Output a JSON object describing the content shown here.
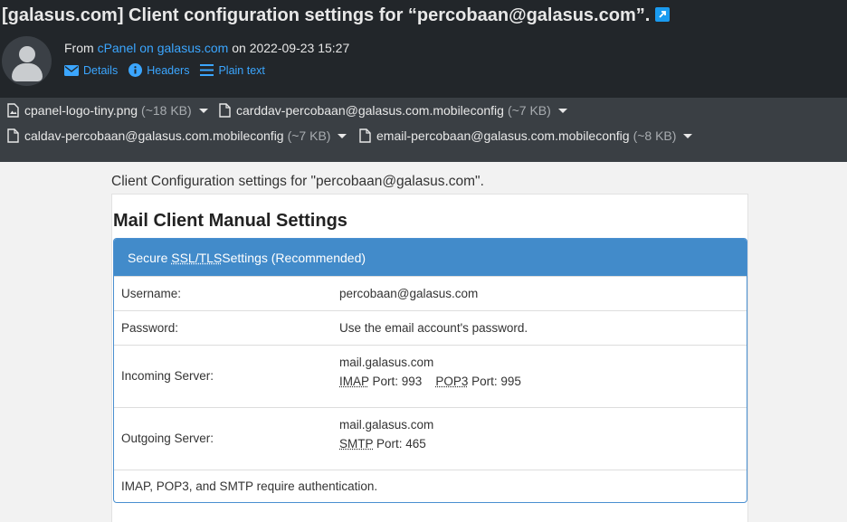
{
  "email": {
    "subject": "[galasus.com] Client configuration settings for “percobaan@galasus.com”.",
    "from_prefix": "From",
    "from_sender": "cPanel on galasus.com",
    "on_label": "on",
    "date": "2022-09-23 15:27",
    "actions": {
      "details": "Details",
      "headers": "Headers",
      "plain_text": "Plain text"
    }
  },
  "attachments": [
    {
      "name": "cpanel-logo-tiny.png",
      "size": "(~18 KB)"
    },
    {
      "name": "carddav-percobaan@galasus.com.mobileconfig",
      "size": "(~7 KB)"
    },
    {
      "name": "caldav-percobaan@galasus.com.mobileconfig",
      "size": "(~7 KB)"
    },
    {
      "name": "email-percobaan@galasus.com.mobileconfig",
      "size": "(~8 KB)"
    }
  ],
  "body": {
    "intro": "Client Configuration settings for \"percobaan@galasus.com\".",
    "heading": "Mail Client Manual Settings",
    "panel_title_pre": "Secure ",
    "panel_title_abbr": "SSL/TLS",
    "panel_title_post": " Settings (Recommended)",
    "rows": {
      "username_label": "Username:",
      "username_value": "percobaan@galasus.com",
      "password_label": "Password:",
      "password_value": "Use the email account's password.",
      "incoming_label": "Incoming Server:",
      "incoming_host": "mail.galasus.com",
      "imap_abbr": "IMAP",
      "imap_port": " Port: 993",
      "pop3_abbr": "POP3",
      "pop3_port": " Port: 995",
      "outgoing_label": "Outgoing Server:",
      "outgoing_host": "mail.galasus.com",
      "smtp_abbr": "SMTP",
      "smtp_port": " Port: 465",
      "auth_note": "IMAP, POP3, and SMTP require authentication."
    }
  },
  "colors": {
    "header_bg": "#22262a",
    "attachment_bg": "#3a3f44",
    "link": "#3ba6ff",
    "panel_blue": "#428bca"
  }
}
